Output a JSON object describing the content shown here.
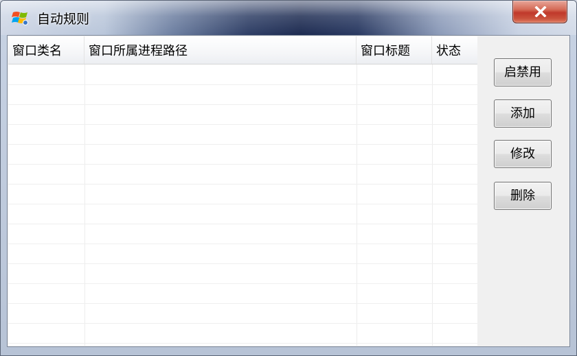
{
  "window": {
    "title": "自动规则",
    "close_symbol": "x"
  },
  "table": {
    "columns": [
      "窗口类名",
      "窗口所属进程路径",
      "窗口标题",
      "状态"
    ],
    "rows": []
  },
  "buttons": {
    "toggle": "启禁用",
    "add": "添加",
    "edit": "修改",
    "delete": "删除"
  },
  "icons": {
    "app": "windows-flag-icon",
    "close": "close-icon"
  },
  "colors": {
    "close_button": "#c9503b",
    "title_bar_dark": "#1e2c52",
    "client_background": "#f0f0f0"
  }
}
